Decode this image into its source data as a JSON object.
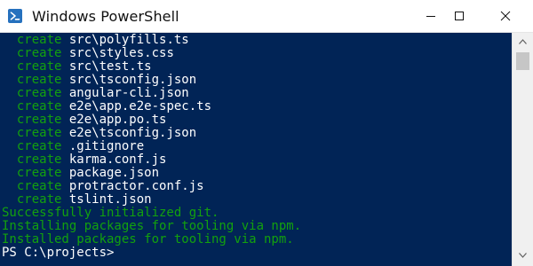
{
  "window": {
    "title": "Windows PowerShell",
    "icon": "powershell-icon",
    "controls": [
      "minimize-icon",
      "maximize-icon",
      "close-icon"
    ]
  },
  "console": {
    "background": "#012456",
    "keyword_color": "#13a10e",
    "text_color": "#ffffff",
    "created_files": [
      {
        "action": "create",
        "path": "src\\polyfills.ts"
      },
      {
        "action": "create",
        "path": "src\\styles.css"
      },
      {
        "action": "create",
        "path": "src\\test.ts"
      },
      {
        "action": "create",
        "path": "src\\tsconfig.json"
      },
      {
        "action": "create",
        "path": "angular-cli.json"
      },
      {
        "action": "create",
        "path": "e2e\\app.e2e-spec.ts"
      },
      {
        "action": "create",
        "path": "e2e\\app.po.ts"
      },
      {
        "action": "create",
        "path": "e2e\\tsconfig.json"
      },
      {
        "action": "create",
        "path": ".gitignore"
      },
      {
        "action": "create",
        "path": "karma.conf.js"
      },
      {
        "action": "create",
        "path": "package.json"
      },
      {
        "action": "create",
        "path": "protractor.conf.js"
      },
      {
        "action": "create",
        "path": "tslint.json"
      }
    ],
    "messages": [
      "Successfully initialized git.",
      "Installing packages for tooling via npm.",
      "Installed packages for tooling via npm."
    ],
    "prompt": "PS C:\\projects>"
  },
  "scrollbar": {
    "up_icon": "scroll-up-arrow-icon",
    "down_icon": "scroll-down-arrow-icon"
  }
}
